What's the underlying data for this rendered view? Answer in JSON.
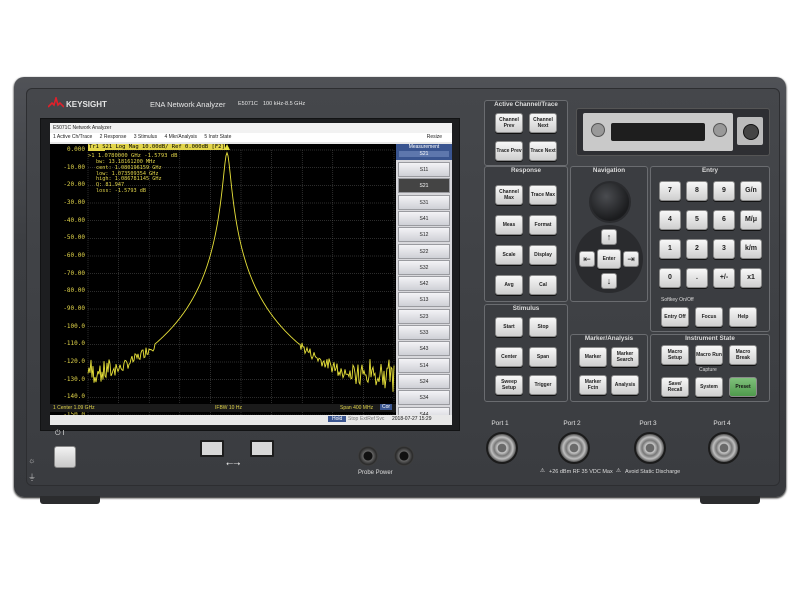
{
  "brand": {
    "name": "KEYSIGHT",
    "product": "ENA Network Analyzer",
    "model": "E5071C",
    "range": "100 kHz-8.5 GHz",
    "logo_color": "#e0202a"
  },
  "screen": {
    "window_title": "E5071C Network Analyzer",
    "resize_label": "Resize",
    "menu": [
      "1 Active Ch/Trace",
      "2 Response",
      "3 Stimulus",
      "4 Mkr/Analysis",
      "5 Instr State"
    ],
    "trace_header": "Tr1  S21 Log Mag 10.00dB/ Ref 0.000dB [F2]",
    "marker_line": ">1  1.0780000 GHz -1.5793 dB",
    "marker_stats": [
      "bw:  13.18161200 MHz",
      "cent:  1.080196159 GHz",
      "low:  1.073509354 GHz",
      "high:  1.086781145 GHz",
      "Q:  81.947",
      "loss:  -1.5793 dB"
    ],
    "y_ticks": [
      "0.000",
      "-10.00",
      "-20.00",
      "-30.00",
      "-40.00",
      "-50.00",
      "-60.00",
      "-70.00",
      "-80.00",
      "-90.00",
      "-100.0",
      "-110.0",
      "-120.0",
      "-130.0",
      "-140.0",
      "-150.0"
    ],
    "bottom_left": "1  Center 1.09 GHz",
    "bottom_mid": "IFBW 10 Hz",
    "bottom_right": "Span 400 MHz",
    "bottom_cor": "Cor",
    "status_hold": "Hold",
    "status_items": [
      "Stop",
      "ExtRef",
      "Svc"
    ],
    "timestamp": "2018-07-27 15:29",
    "measurement_title": "Measurement",
    "measurement_current": "S21",
    "measurement_items": [
      "S11",
      "S21",
      "S31",
      "S41",
      "S12",
      "S22",
      "S32",
      "S42",
      "S13",
      "S23",
      "S33",
      "S43",
      "S14",
      "S24",
      "S34",
      "S44"
    ],
    "trace_color": "#e8e23a",
    "plot_bg": "#000000"
  },
  "active_channel": {
    "title": "Active Channel/Trace",
    "keys": [
      "Channel Prev",
      "Channel Next",
      "Trace Prev",
      "Trace Next"
    ]
  },
  "response": {
    "title": "Response",
    "keys": [
      "Channel Max",
      "Trace Max",
      "Meas",
      "Format",
      "Scale",
      "Display",
      "Avg",
      "Cal"
    ]
  },
  "navigation": {
    "title": "Navigation",
    "enter": "Enter"
  },
  "entry": {
    "title": "Entry",
    "keys": [
      "7",
      "8",
      "9",
      "G/n",
      "4",
      "5",
      "6",
      "M/μ",
      "1",
      "2",
      "3",
      "k/m",
      "0",
      ".",
      "+/-",
      "x1"
    ],
    "softkey_label": "Softkey On/Off",
    "lower_keys": [
      "Entry Off",
      "Focus",
      "Help"
    ]
  },
  "stimulus": {
    "title": "Stimulus",
    "keys": [
      "Start",
      "Stop",
      "Center",
      "Span",
      "Sweep Setup",
      "Trigger"
    ]
  },
  "marker_analysis": {
    "title": "Marker/Analysis",
    "keys": [
      "Marker",
      "Marker Search",
      "Marker Fctn",
      "Analysis"
    ]
  },
  "instrument_state": {
    "title": "Instrument State",
    "keys": [
      "Macro Setup",
      "Macro Run",
      "Macro Break"
    ],
    "capture_label": "Capture",
    "lower_keys": [
      "Save/ Recall",
      "System",
      "Preset"
    ]
  },
  "ports": [
    "Port 1",
    "Port 2",
    "Port 3",
    "Port 4"
  ],
  "port_warning": "+26 dBm RF  35 VDC Max",
  "static_warning": "Avoid Static Discharge",
  "probe_power": "Probe Power",
  "power_symbol": "⏻ I"
}
